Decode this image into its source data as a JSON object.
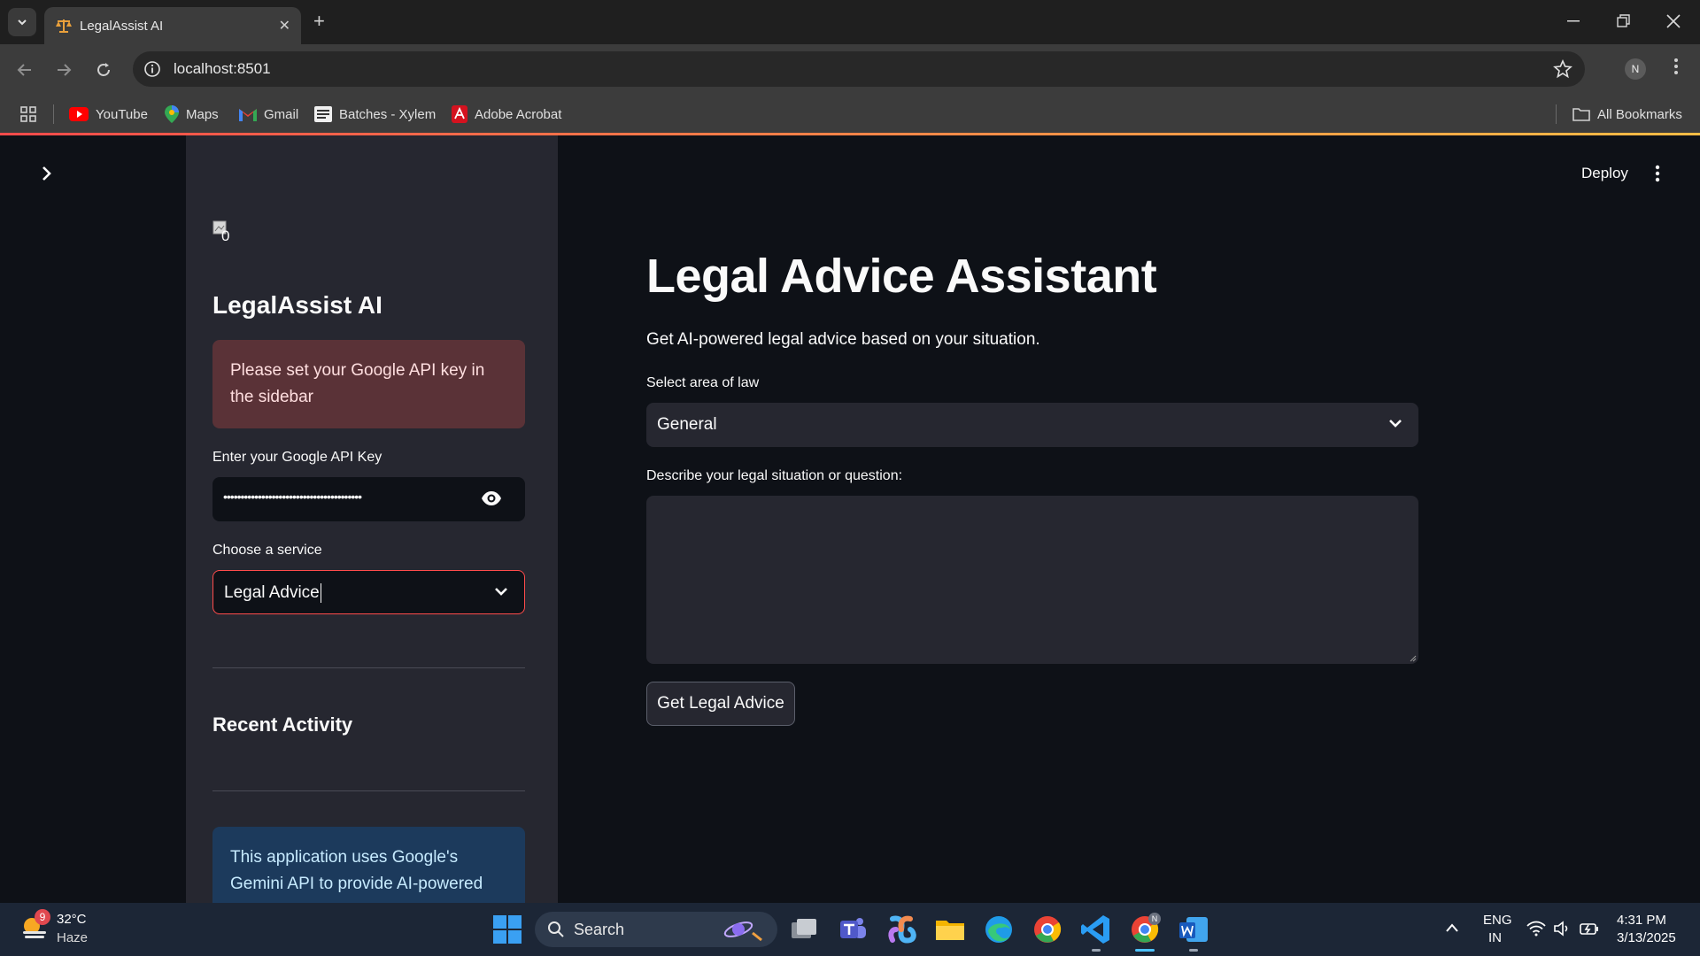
{
  "browser": {
    "tab_title": "LegalAssist AI",
    "url": "localhost:8501",
    "profile_initial": "N",
    "bookmarks": [
      "YouTube",
      "Maps",
      "Gmail",
      "Batches - Xylem",
      "Adobe Acrobat"
    ],
    "all_bookmarks_label": "All Bookmarks"
  },
  "sidebar": {
    "logo_alt": "0",
    "title": "LegalAssist AI",
    "api_warning": "Please set your Google API key in the sidebar",
    "api_key_label": "Enter your Google API Key",
    "api_key_masked": "••••••••••••••••••••••••••••••••••••••••",
    "service_label": "Choose a service",
    "service_value": "Legal Advice",
    "recent_activity_title": "Recent Activity",
    "info_text": "This application uses Google's Gemini API to provide AI-powered"
  },
  "header": {
    "deploy_label": "Deploy"
  },
  "main": {
    "title": "Legal Advice Assistant",
    "subtitle": "Get AI-powered legal advice based on your situation.",
    "area_label": "Select area of law",
    "area_value": "General",
    "situation_label": "Describe your legal situation or question:",
    "situation_value": "",
    "submit_label": "Get Legal Advice"
  },
  "taskbar": {
    "weather_temp": "32°C",
    "weather_condition": "Haze",
    "weather_badge": "9",
    "search_label": "Search",
    "language": "ENG",
    "region": "IN",
    "time": "4:31 PM",
    "date": "3/13/2025"
  },
  "colors": {
    "accent": "#ff4b4b",
    "sidebar_bg": "#262730",
    "app_bg": "#0e1117",
    "error_bg": "#5a3237",
    "info_bg": "#1c3a5c"
  }
}
